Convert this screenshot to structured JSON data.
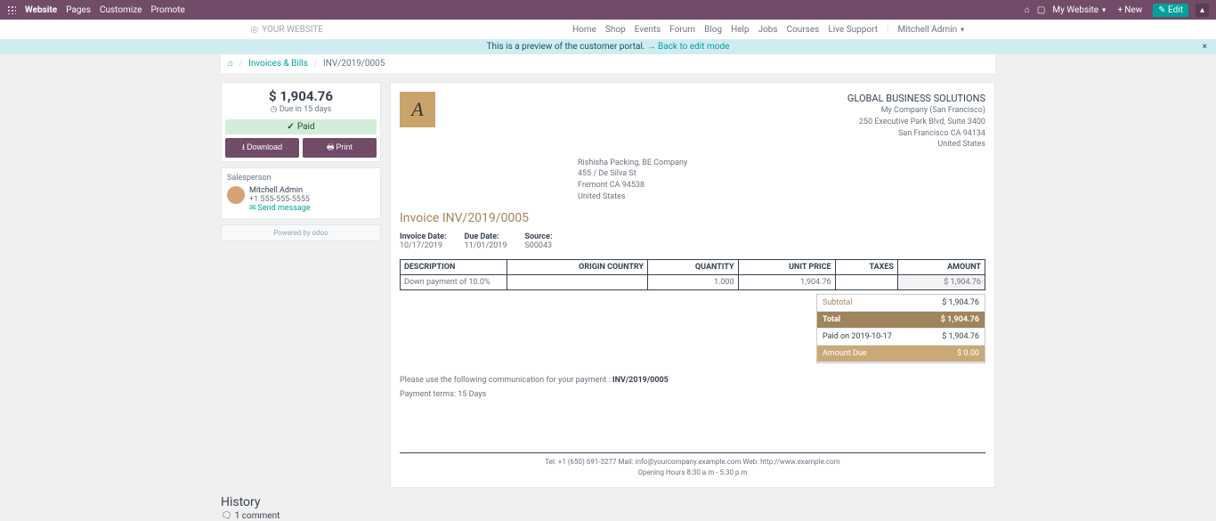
{
  "topbar": {
    "brand": "Website",
    "menu": {
      "pages": "Pages",
      "customize": "Customize",
      "promote": "Promote"
    },
    "my_website": "My Website",
    "new": "New",
    "edit": "Edit"
  },
  "navbar": {
    "brand": "YOUR WEBSITE",
    "items": {
      "home": "Home",
      "shop": "Shop",
      "events": "Events",
      "forum": "Forum",
      "blog": "Blog",
      "help": "Help",
      "jobs": "Jobs",
      "courses": "Courses",
      "live": "Live Support",
      "admin": "Mitchell Admin"
    }
  },
  "preview": {
    "text": "This is a preview of the customer portal.",
    "back": "Back to edit mode"
  },
  "breadcrumb": {
    "invoices": "Invoices & Bills",
    "current": "INV/2019/0005"
  },
  "sidebar": {
    "amount": "$ 1,904.76",
    "due": "Due in 15 days",
    "paid": "Paid",
    "download": "Download",
    "print": "Print",
    "salesperson_label": "Salesperson",
    "sp_name": "Mitchell Admin",
    "sp_phone": "+1 555-555-5555",
    "send": "Send message",
    "powered": "Powered by odoo"
  },
  "doc": {
    "company": {
      "name": "GLOBAL BUSINESS SOLUTIONS",
      "l1": "My Company (San Francisco)",
      "l2": "250 Executive Park Blvd, Suite 3400",
      "l3": "San Francisco CA 94134",
      "l4": "United States"
    },
    "customer": {
      "l1": "Rishisha Packing, BE Company",
      "l2": "455 / De Silva St",
      "l3": "Fremont CA 94538",
      "l4": "United States"
    },
    "title": "Invoice INV/2019/0005",
    "meta": {
      "h1": "Invoice Date:",
      "v1": "10/17/2019",
      "h2": "Due Date:",
      "v2": "11/01/2019",
      "h3": "Source:",
      "v3": "S00043"
    },
    "th": {
      "desc": "DESCRIPTION",
      "origin": "ORIGIN COUNTRY",
      "qty": "QUANTITY",
      "price": "UNIT PRICE",
      "taxes": "TAXES",
      "amount": "AMOUNT"
    },
    "line": {
      "desc": "Down payment of 10.0%",
      "origin": "",
      "qty": "1.000",
      "price": "1,904.76",
      "taxes": "",
      "amount": "$ 1,904.76"
    },
    "totals": {
      "subtotal_l": "Subtotal",
      "subtotal_v": "$ 1,904.76",
      "total_l": "Total",
      "total_v": "$ 1,904.76",
      "paid_l": "Paid on 2019-10-17",
      "paid_v": "$ 1,904.76",
      "due_l": "Amount Due",
      "due_v": "$ 0.00"
    },
    "comm": {
      "pre": "Please use the following communication for your payment : ",
      "ref": "INV/2019/0005"
    },
    "terms": "Payment terms: 15 Days",
    "footer": {
      "l1": "Tel: +1 (650) 691-3277   Mail: info@yourcompany.example.com   Web: http://www.example.com",
      "l2": "Opening Hours 8:30 a.m - 5:30 p.m"
    }
  },
  "history": {
    "title": "History",
    "comments": "1 comment"
  }
}
